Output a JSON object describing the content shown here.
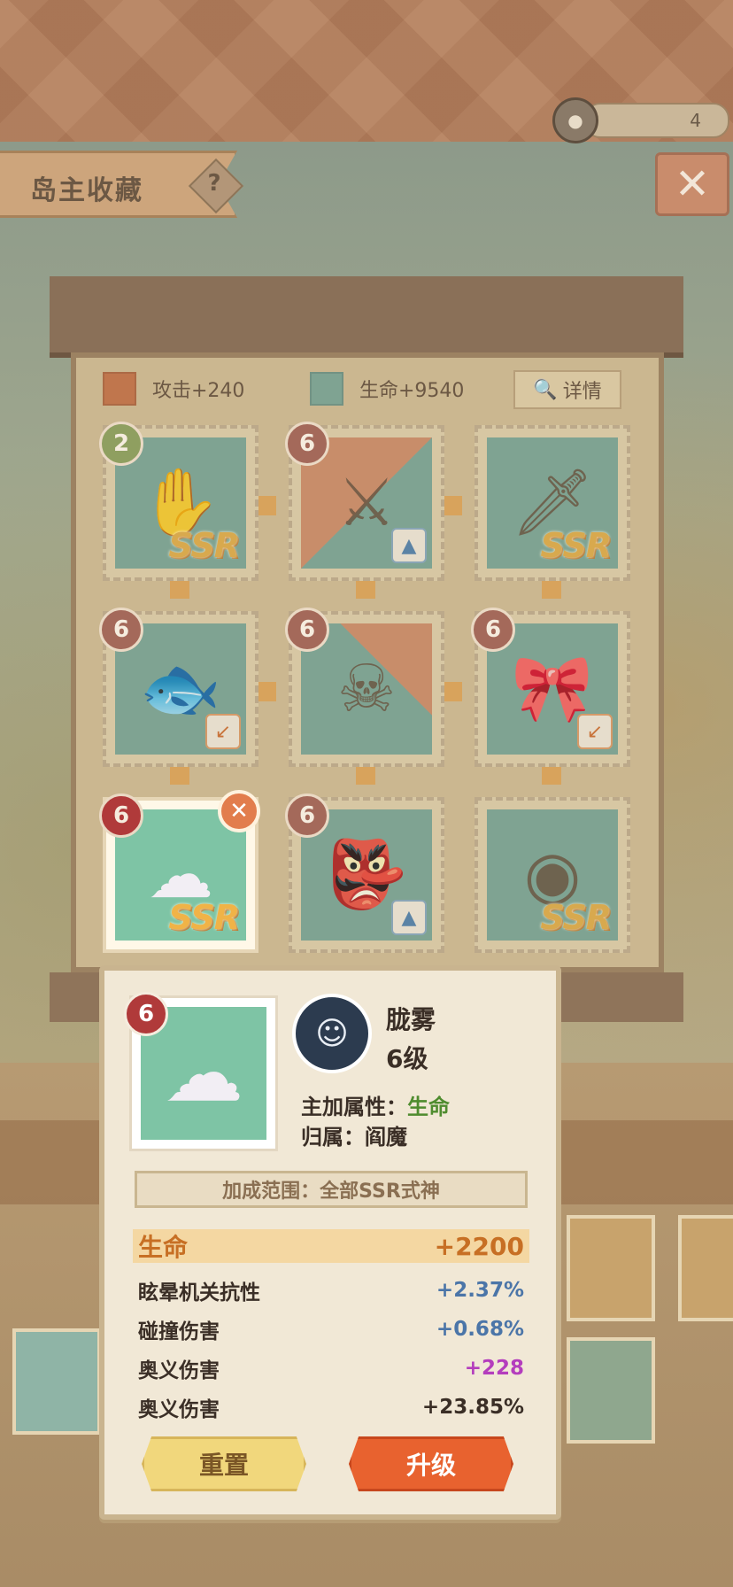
{
  "header": {
    "title": "岛主收藏",
    "help_label": "?",
    "close_label": "✕",
    "currency_value": "4",
    "currency_icon": "coin-icon"
  },
  "cabinet": {
    "attack_label": "攻击+240",
    "life_label": "生命+9540",
    "detail_label": "详情",
    "attack_color": "#c0764d",
    "life_color": "#7fa392"
  },
  "slots": [
    {
      "level": "2",
      "badge_color": "green",
      "item": "hand-charm",
      "rarity": "SSR"
    },
    {
      "level": "6",
      "item": "katana",
      "type_icon": "tree"
    },
    {
      "level": "",
      "item": "broken-blade",
      "rarity": "SSR"
    },
    {
      "level": "6",
      "item": "fish",
      "type_icon": "arrow"
    },
    {
      "level": "6",
      "item": "skull-ghost",
      "type_icon": ""
    },
    {
      "level": "6",
      "item": "ribbon",
      "type_icon": "arrow"
    },
    {
      "level": "6",
      "item": "mist",
      "rarity": "SSR",
      "selected": true
    },
    {
      "level": "6",
      "item": "oni-masks",
      "type_icon": "tree"
    },
    {
      "level": "",
      "item": "dark-orb",
      "rarity": "SSR"
    }
  ],
  "popup": {
    "level_badge": "6",
    "name": "胧雾",
    "level_text": "6级",
    "main_attr_label": "主加属性：",
    "main_attr_value": "生命",
    "belong_label": "归属：",
    "belong_value": "阎魔",
    "range_text": "加成范围：全部SSR式神",
    "stats": [
      {
        "name": "生命",
        "value": "+2200"
      },
      {
        "name": "眩晕机关抗性",
        "value": "+2.37%"
      },
      {
        "name": "碰撞伤害",
        "value": "+0.68%"
      },
      {
        "name": "奥义伤害",
        "value": "+228"
      },
      {
        "name": "奥义伤害",
        "value": "+23.85%"
      }
    ],
    "reset_label": "重置",
    "upgrade_label": "升级"
  }
}
